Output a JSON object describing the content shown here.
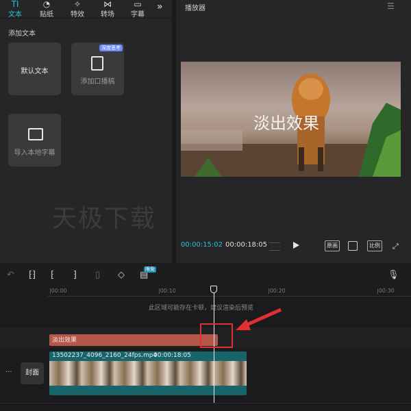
{
  "tabs": [
    {
      "label": "文本",
      "icon": "text-icon",
      "active": true
    },
    {
      "label": "贴纸",
      "icon": "sticker-icon",
      "active": false
    },
    {
      "label": "特效",
      "icon": "effects-icon",
      "active": false
    },
    {
      "label": "转场",
      "icon": "transition-icon",
      "active": false
    },
    {
      "label": "字幕",
      "icon": "subtitle-icon",
      "active": false
    }
  ],
  "more_symbol": "»",
  "left": {
    "section_label": "添加文本",
    "cards": {
      "default_text": "默认文本",
      "add_script": "添加口播稿",
      "add_script_badge": "深度思考",
      "import_subtitle": "导入本地字幕"
    },
    "watermark": "天极下载"
  },
  "player": {
    "title": "播放器",
    "overlay_text": "淡出效果",
    "current_time": "00:00:15:02",
    "total_time": "00:00:18:05",
    "btn_original": "原画",
    "btn_ratio": "比例"
  },
  "toolbar": {
    "limited_badge": "限免"
  },
  "timeline": {
    "ticks": [
      "|00:00",
      "|00:10",
      "|00:20",
      "|00:30"
    ],
    "hint": "此区域可能存在卡顿，建议渲染后预览",
    "text_clip_label": "淡出效果",
    "video_clip_label": "13502237_4096_2160_24fps.mp4",
    "video_clip_duration": "00:00:18:05",
    "cover_label": "封面",
    "more_dots": "···"
  },
  "colors": {
    "accent": "#25c5d5",
    "text_clip": "#b5564a",
    "video_clip": "#17646a",
    "highlight": "#e03030"
  }
}
